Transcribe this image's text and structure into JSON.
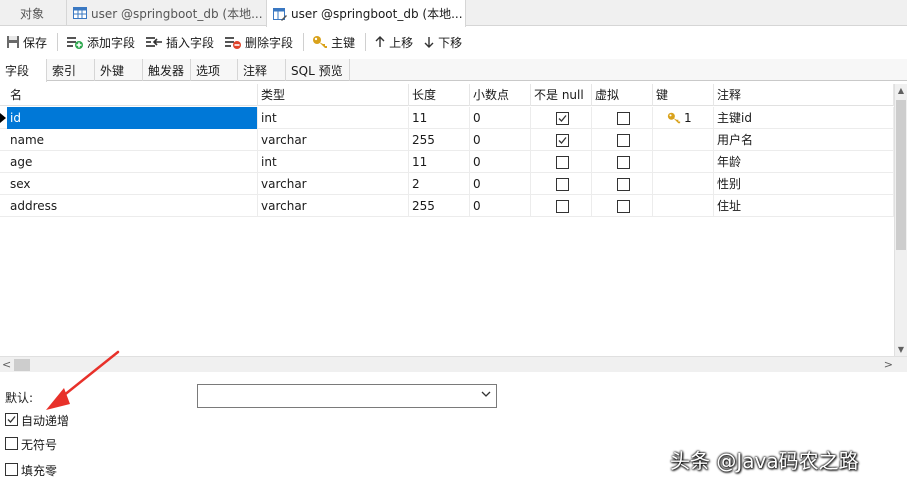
{
  "tabs": {
    "objects": "对象",
    "tab1": "user @springboot_db (本地...",
    "tab2": "user @springboot_db (本地..."
  },
  "toolbar": {
    "save": "保存",
    "add_field": "添加字段",
    "insert_field": "插入字段",
    "delete_field": "删除字段",
    "primary_key": "主键",
    "move_up": "上移",
    "move_down": "下移"
  },
  "subtabs": [
    "字段",
    "索引",
    "外键",
    "触发器",
    "选项",
    "注释",
    "SQL 预览"
  ],
  "columns": [
    "名",
    "类型",
    "长度",
    "小数点",
    "不是 null",
    "虚拟",
    "键",
    "注释"
  ],
  "rows": [
    {
      "name": "id",
      "type": "int",
      "length": "11",
      "decimals": "0",
      "not_null": true,
      "virtual": false,
      "key": "1",
      "comment": "主键id"
    },
    {
      "name": "name",
      "type": "varchar",
      "length": "255",
      "decimals": "0",
      "not_null": true,
      "virtual": false,
      "key": "",
      "comment": "用户名"
    },
    {
      "name": "age",
      "type": "int",
      "length": "11",
      "decimals": "0",
      "not_null": false,
      "virtual": false,
      "key": "",
      "comment": "年龄"
    },
    {
      "name": "sex",
      "type": "varchar",
      "length": "2",
      "decimals": "0",
      "not_null": false,
      "virtual": false,
      "key": "",
      "comment": "性别"
    },
    {
      "name": "address",
      "type": "varchar",
      "length": "255",
      "decimals": "0",
      "not_null": false,
      "virtual": false,
      "key": "",
      "comment": "住址"
    }
  ],
  "props": {
    "default_label": "默认:",
    "default_value": "",
    "auto_increment_label": "自动递增",
    "auto_increment": true,
    "unsigned_label": "无符号",
    "unsigned": false,
    "zerofill_label": "填充零",
    "zerofill": false
  },
  "watermark": "头条 @Java码农之路",
  "colors": {
    "selection": "#0078d7",
    "annotation_arrow": "#e8312a",
    "key_icon": "#d9a21b"
  },
  "icons": [
    "table-icon",
    "design-table-icon",
    "save-icon",
    "add-field-icon",
    "insert-field-icon",
    "delete-field-icon",
    "key-icon",
    "arrow-up-icon",
    "arrow-down-icon",
    "chevron-down-icon",
    "check-icon",
    "row-pointer-icon"
  ]
}
